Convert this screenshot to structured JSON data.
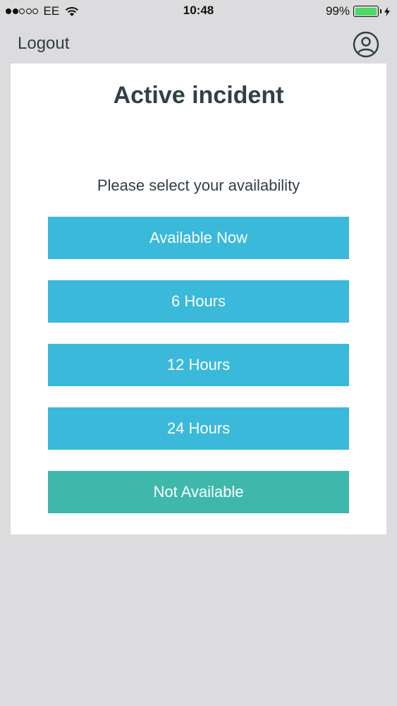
{
  "status_bar": {
    "carrier": "EE",
    "time": "10:48",
    "battery_percent": "99%",
    "battery_level": 0.99,
    "signal_strength_dots": 2,
    "signal_total_dots": 5
  },
  "nav": {
    "logout_label": "Logout",
    "profile_icon": "user-circle-icon"
  },
  "card": {
    "title": "Active incident",
    "subtitle": "Please select your availability",
    "options": [
      {
        "label": "Available Now"
      },
      {
        "label": "6 Hours"
      },
      {
        "label": "12 Hours"
      },
      {
        "label": "24 Hours"
      },
      {
        "label": "Not Available"
      }
    ]
  },
  "colors": {
    "primary_button": "#3ab9da",
    "not_available_button": "#3fb8ab",
    "background": "#dcdbdd",
    "card": "#ffffff",
    "text": "#2e3f44",
    "battery": "#4cd964"
  }
}
